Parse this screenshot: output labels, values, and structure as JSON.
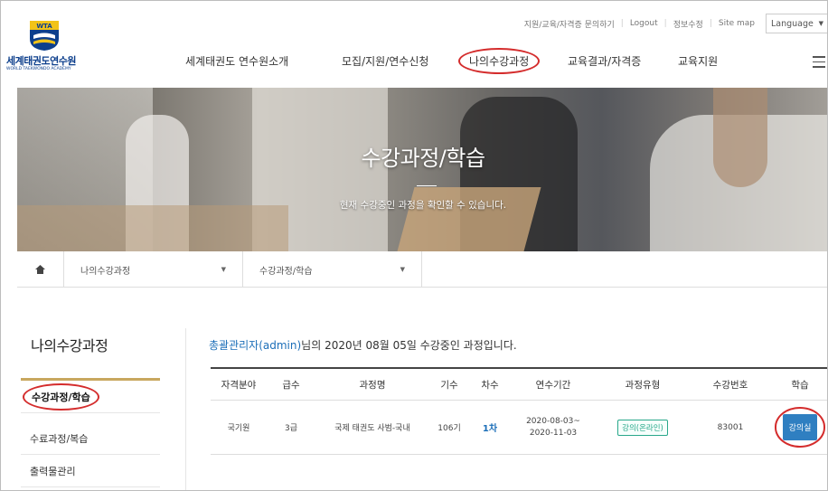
{
  "header": {
    "logo": {
      "badge": "WTA",
      "korean_name": "세계태권도연수원",
      "english_name": "WORLD TAEKWONDO ACADEMY"
    },
    "utility_links": [
      "지원/교육/자격증 문의하기",
      "Logout",
      "정보수정",
      "Site map"
    ],
    "language_label": "Language",
    "nav": [
      "세계태권도 연수원소개",
      "모집/지원/연수신청",
      "나의수강과정",
      "교육결과/자격증",
      "교육지원"
    ],
    "active_nav": "나의수강과정"
  },
  "banner": {
    "title": "수강과정/학습",
    "subtitle": "현재 수강중인 과정을 확인할 수 있습니다."
  },
  "breadcrumb": {
    "level1": "나의수강과정",
    "level2": "수강과정/학습"
  },
  "sidebar": {
    "title": "나의수강과정",
    "items": [
      {
        "label": "수강과정/학습",
        "active": true
      },
      {
        "label": "수료과정/복습",
        "active": false
      },
      {
        "label": "출력물관리",
        "active": false
      }
    ]
  },
  "main": {
    "intro_user": "총괄관리자(admin)",
    "intro_text": "님의 2020년 08월 05일 수강중인 과정입니다.",
    "table": {
      "headers": [
        "자격분야",
        "급수",
        "과정명",
        "기수",
        "차수",
        "연수기간",
        "과정유형",
        "수강번호",
        "학습"
      ],
      "rows": [
        {
          "field": "국기원",
          "grade": "3급",
          "course": "국제 태권도 사범-국내",
          "term": "106기",
          "round": "1차",
          "period_start": "2020-08-03~",
          "period_end": "2020-11-03",
          "type": "강의(온라인)",
          "number": "83001",
          "action": "강의실"
        }
      ]
    }
  },
  "colors": {
    "accent_red": "#d42c2c",
    "link_blue": "#1b6eb8",
    "button_blue": "#2f7fc1",
    "badge_green": "#29a88b",
    "sidebar_gold": "#c8a75e",
    "brand_navy": "#0d3f8c"
  }
}
